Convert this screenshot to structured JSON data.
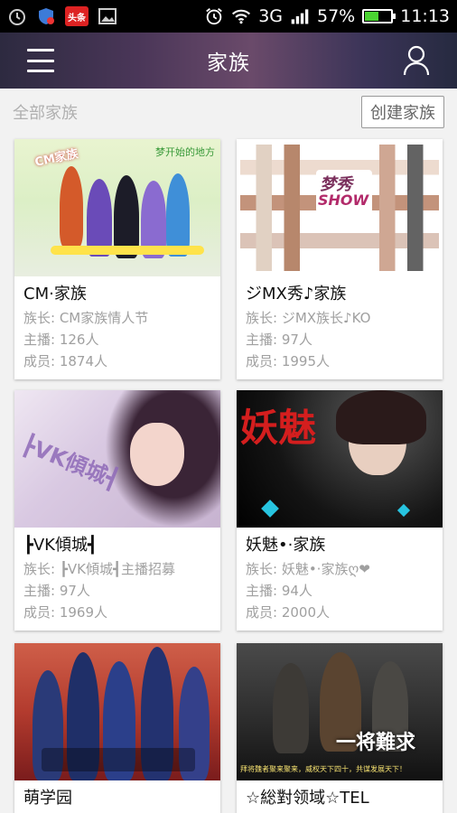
{
  "status_bar": {
    "network": "3G",
    "battery": "57%",
    "battery_level": 0.57,
    "time": "11:13",
    "notification_badge": "头条"
  },
  "header": {
    "title": "家族"
  },
  "subheader": {
    "section_title": "全部家族",
    "create_button": "创建家族"
  },
  "families": [
    {
      "name": "CM·家族",
      "leader": "族长: CM家族情人节",
      "anchors": "主播: 126人",
      "members": "成员: 1874人",
      "thumb_text_1": "CM家族",
      "thumb_text_2": "梦开始的地方"
    },
    {
      "name": "ジMX秀♪家族",
      "leader": "族长: ジMX族长♪KO",
      "anchors": "主播: 97人",
      "members": "成员: 1995人",
      "thumb_text_1": "梦秀",
      "thumb_text_2": "SHOW"
    },
    {
      "name": "┣VK傾城┫",
      "leader": "族长: ┣VK傾城┫主播招募",
      "anchors": "主播: 97人",
      "members": "成员: 1969人",
      "thumb_text_1": "┣VK傾城┫"
    },
    {
      "name": "妖魅•·家族",
      "leader": "族长: 妖魅•·家族ღ❤",
      "anchors": "主播: 94人",
      "members": "成员: 2000人",
      "thumb_text_1": "妖魅"
    },
    {
      "name": "萌学园"
    },
    {
      "name": "☆総對领域☆TEL",
      "thumb_text_1": "一将難求",
      "thumb_text_2": "拜将魏者聚来聚来，威权天下四十，共谋发展天下！"
    }
  ],
  "colors": {
    "background": "#f2f2f2",
    "header_gradient_mid": "#6a4a6a",
    "meta_text": "#a0a0a0",
    "battery_green": "#4bd432"
  }
}
